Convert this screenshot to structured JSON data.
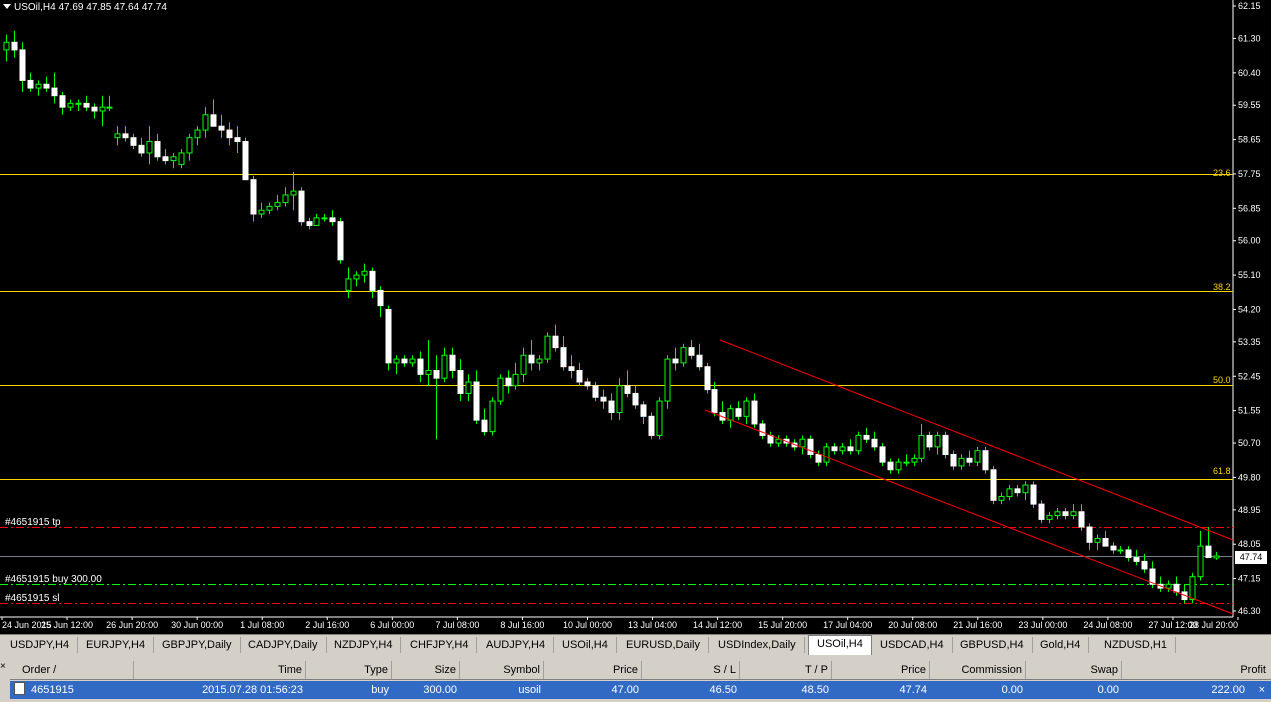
{
  "chart": {
    "title": "USOil,H4  47.69 47.85 47.64 47.74",
    "price_labels": [
      "62.15",
      "61.30",
      "60.40",
      "59.55",
      "58.65",
      "57.75",
      "56.85",
      "56.00",
      "55.10",
      "54.20",
      "53.35",
      "52.45",
      "51.55",
      "50.70",
      "49.80",
      "48.95",
      "48.05",
      "47.15",
      "46.30"
    ],
    "time_labels": [
      "24 Jun 2015",
      "25 Jun 12:00",
      "26 Jun 20:00",
      "30 Jun 00:00",
      "1 Jul 08:00",
      "2 Jul 16:00",
      "6 Jul 00:00",
      "7 Jul 08:00",
      "8 Jul 16:00",
      "10 Jul 00:00",
      "13 Jul 04:00",
      "14 Jul 12:00",
      "15 Jul 20:00",
      "17 Jul 04:00",
      "20 Jul 08:00",
      "21 Jul 16:00",
      "23 Jul 00:00",
      "24 Jul 08:00",
      "27 Jul 12:00",
      "28 Jul 20:00"
    ],
    "fib_levels": [
      "23.6",
      "38.2",
      "50.0",
      "61.8"
    ],
    "fib_level_values": [
      57.75,
      54.69,
      52.22,
      49.75
    ],
    "current_price": "47.74",
    "orders": {
      "tp_label": "#4651915 tp",
      "buy_label": "#4651915 buy 300.00",
      "sl_label": "#4651915 sl",
      "tp": 48.5,
      "buy": 47.0,
      "sl": 46.5
    },
    "colors": {
      "background": "#000000",
      "candle_up": "#ffffff",
      "candle_down": "#00ff00",
      "fib_line": "#ffd700",
      "channel": "#ff0000",
      "tp_sl_line": "#ff0000",
      "buy_line": "#00ff00",
      "current_price_line": "#708090"
    },
    "candles": [
      [
        61.0,
        61.4,
        60.7,
        61.2
      ],
      [
        61.2,
        61.5,
        60.8,
        61.0
      ],
      [
        61.0,
        61.2,
        59.9,
        60.2
      ],
      [
        60.2,
        60.4,
        59.9,
        60.0
      ],
      [
        60.0,
        60.2,
        59.8,
        60.1
      ],
      [
        60.1,
        60.3,
        59.9,
        60.0
      ],
      [
        60.0,
        60.4,
        59.6,
        59.8
      ],
      [
        59.8,
        59.9,
        59.3,
        59.5
      ],
      [
        59.5,
        59.7,
        59.4,
        59.6
      ],
      [
        59.6,
        59.7,
        59.4,
        59.6
      ],
      [
        59.6,
        59.8,
        59.4,
        59.5
      ],
      [
        59.5,
        59.6,
        59.2,
        59.4
      ],
      [
        59.4,
        59.8,
        59.0,
        59.5
      ],
      [
        59.5,
        59.8,
        59.4,
        59.5
      ],
      [
        58.7,
        59.0,
        58.5,
        58.8
      ],
      [
        58.8,
        59.0,
        58.6,
        58.7
      ],
      [
        58.7,
        58.8,
        58.4,
        58.5
      ],
      [
        58.5,
        58.7,
        58.2,
        58.3
      ],
      [
        58.3,
        59.0,
        58.0,
        58.6
      ],
      [
        58.6,
        58.8,
        58.1,
        58.2
      ],
      [
        58.2,
        58.4,
        58.0,
        58.1
      ],
      [
        58.1,
        58.3,
        57.9,
        58.2
      ],
      [
        58.0,
        58.4,
        57.9,
        58.3
      ],
      [
        58.3,
        58.8,
        58.1,
        58.7
      ],
      [
        58.7,
        59.0,
        58.5,
        58.9
      ],
      [
        58.9,
        59.5,
        58.7,
        59.3
      ],
      [
        59.3,
        59.7,
        59.0,
        59.0
      ],
      [
        59.0,
        59.3,
        58.7,
        58.9
      ],
      [
        58.9,
        59.1,
        58.5,
        58.7
      ],
      [
        58.7,
        59.0,
        58.3,
        58.6
      ],
      [
        58.6,
        58.7,
        57.6,
        57.6
      ],
      [
        57.6,
        57.7,
        56.5,
        56.7
      ],
      [
        56.7,
        57.0,
        56.6,
        56.8
      ],
      [
        56.8,
        57.0,
        56.7,
        56.9
      ],
      [
        56.9,
        57.2,
        56.8,
        57.0
      ],
      [
        57.0,
        57.4,
        56.9,
        57.2
      ],
      [
        57.2,
        57.8,
        56.8,
        57.3
      ],
      [
        57.3,
        57.4,
        56.4,
        56.5
      ],
      [
        56.5,
        56.6,
        56.3,
        56.4
      ],
      [
        56.4,
        56.7,
        56.4,
        56.6
      ],
      [
        56.6,
        56.7,
        56.5,
        56.6
      ],
      [
        56.6,
        56.8,
        56.4,
        56.5
      ],
      [
        56.5,
        56.6,
        55.4,
        55.5
      ],
      [
        54.7,
        55.3,
        54.5,
        55.0
      ],
      [
        55.0,
        55.2,
        54.8,
        55.1
      ],
      [
        55.1,
        55.4,
        54.9,
        55.2
      ],
      [
        55.2,
        55.3,
        54.5,
        54.7
      ],
      [
        54.7,
        54.8,
        54.0,
        54.3
      ],
      [
        54.2,
        54.3,
        52.6,
        52.8
      ],
      [
        52.8,
        53.0,
        52.5,
        52.9
      ],
      [
        52.9,
        53.0,
        52.7,
        52.8
      ],
      [
        52.8,
        53.0,
        52.7,
        52.9
      ],
      [
        52.9,
        53.1,
        52.3,
        52.5
      ],
      [
        52.5,
        53.4,
        52.2,
        52.6
      ],
      [
        52.6,
        53.0,
        50.8,
        52.4
      ],
      [
        52.4,
        53.2,
        52.3,
        53.0
      ],
      [
        53.0,
        53.2,
        52.4,
        52.6
      ],
      [
        52.6,
        52.9,
        51.8,
        52.0
      ],
      [
        52.0,
        52.5,
        51.8,
        52.3
      ],
      [
        52.3,
        52.6,
        51.2,
        51.3
      ],
      [
        51.3,
        51.6,
        50.9,
        51.0
      ],
      [
        51.0,
        51.9,
        50.9,
        51.8
      ],
      [
        51.8,
        52.5,
        51.7,
        52.4
      ],
      [
        52.4,
        52.6,
        52.0,
        52.2
      ],
      [
        52.2,
        52.8,
        52.1,
        52.5
      ],
      [
        52.5,
        53.2,
        52.3,
        53.0
      ],
      [
        53.0,
        53.4,
        52.6,
        52.8
      ],
      [
        52.8,
        53.0,
        52.6,
        52.9
      ],
      [
        52.9,
        53.6,
        52.8,
        53.5
      ],
      [
        53.5,
        53.8,
        53.1,
        53.2
      ],
      [
        53.2,
        53.5,
        52.6,
        52.7
      ],
      [
        52.7,
        53.0,
        52.4,
        52.6
      ],
      [
        52.6,
        52.8,
        52.2,
        52.3
      ],
      [
        52.3,
        52.4,
        52.1,
        52.2
      ],
      [
        52.2,
        52.3,
        51.8,
        51.9
      ],
      [
        51.9,
        52.1,
        51.6,
        51.8
      ],
      [
        51.8,
        52.0,
        51.3,
        51.5
      ],
      [
        51.5,
        52.4,
        51.3,
        52.2
      ],
      [
        52.2,
        52.6,
        51.9,
        52.0
      ],
      [
        52.0,
        52.2,
        51.6,
        51.7
      ],
      [
        51.7,
        51.8,
        51.2,
        51.4
      ],
      [
        51.4,
        51.5,
        50.8,
        50.9
      ],
      [
        50.9,
        51.9,
        50.8,
        51.8
      ],
      [
        51.8,
        53.0,
        51.6,
        52.9
      ],
      [
        52.9,
        53.2,
        52.6,
        52.8
      ],
      [
        52.8,
        53.3,
        52.7,
        53.2
      ],
      [
        53.2,
        53.4,
        52.9,
        53.0
      ],
      [
        53.0,
        53.3,
        52.6,
        52.7
      ],
      [
        52.7,
        52.8,
        52.0,
        52.1
      ],
      [
        52.1,
        52.3,
        51.4,
        51.5
      ],
      [
        51.5,
        51.8,
        51.2,
        51.3
      ],
      [
        51.3,
        51.7,
        51.1,
        51.6
      ],
      [
        51.6,
        51.8,
        51.3,
        51.4
      ],
      [
        51.4,
        51.9,
        51.2,
        51.8
      ],
      [
        51.8,
        52.0,
        51.1,
        51.2
      ],
      [
        51.2,
        51.3,
        50.8,
        50.9
      ],
      [
        50.9,
        51.0,
        50.6,
        50.7
      ],
      [
        50.7,
        50.9,
        50.6,
        50.8
      ],
      [
        50.8,
        50.9,
        50.6,
        50.7
      ],
      [
        50.7,
        50.8,
        50.5,
        50.6
      ],
      [
        50.6,
        50.9,
        50.4,
        50.8
      ],
      [
        50.8,
        50.9,
        50.3,
        50.4
      ],
      [
        50.4,
        50.5,
        50.1,
        50.2
      ],
      [
        50.2,
        50.7,
        50.1,
        50.6
      ],
      [
        50.6,
        50.7,
        50.4,
        50.5
      ],
      [
        50.5,
        50.7,
        50.4,
        50.6
      ],
      [
        50.6,
        50.8,
        50.4,
        50.5
      ],
      [
        50.5,
        51.0,
        50.4,
        50.9
      ],
      [
        50.9,
        51.1,
        50.7,
        50.8
      ],
      [
        50.8,
        51.0,
        50.5,
        50.6
      ],
      [
        50.6,
        50.7,
        50.1,
        50.2
      ],
      [
        50.2,
        50.3,
        49.9,
        50.0
      ],
      [
        50.0,
        50.3,
        49.9,
        50.2
      ],
      [
        50.2,
        50.4,
        50.1,
        50.2
      ],
      [
        50.2,
        50.4,
        50.1,
        50.3
      ],
      [
        50.3,
        51.2,
        50.2,
        50.9
      ],
      [
        50.9,
        51.0,
        50.5,
        50.6
      ],
      [
        50.6,
        51.0,
        50.4,
        50.9
      ],
      [
        50.9,
        51.0,
        50.3,
        50.4
      ],
      [
        50.4,
        50.5,
        50.0,
        50.1
      ],
      [
        50.1,
        50.4,
        50.0,
        50.3
      ],
      [
        50.3,
        50.5,
        50.1,
        50.2
      ],
      [
        50.2,
        50.6,
        50.1,
        50.5
      ],
      [
        50.5,
        50.6,
        49.9,
        50.0
      ],
      [
        50.0,
        50.1,
        49.1,
        49.2
      ],
      [
        49.2,
        49.4,
        49.1,
        49.3
      ],
      [
        49.3,
        49.6,
        49.2,
        49.5
      ],
      [
        49.5,
        49.6,
        49.3,
        49.4
      ],
      [
        49.4,
        49.7,
        49.2,
        49.6
      ],
      [
        49.6,
        49.7,
        49.0,
        49.1
      ],
      [
        49.1,
        49.2,
        48.6,
        48.7
      ],
      [
        48.7,
        48.9,
        48.6,
        48.8
      ],
      [
        48.8,
        49.0,
        48.7,
        48.9
      ],
      [
        48.9,
        49.0,
        48.7,
        48.8
      ],
      [
        48.8,
        49.1,
        48.7,
        48.9
      ],
      [
        48.9,
        49.1,
        48.4,
        48.5
      ],
      [
        48.5,
        48.6,
        47.9,
        48.1
      ],
      [
        48.1,
        48.3,
        47.9,
        48.2
      ],
      [
        48.2,
        48.4,
        48.0,
        48.0
      ],
      [
        48.0,
        48.1,
        47.8,
        47.9
      ],
      [
        47.9,
        48.0,
        47.8,
        47.9
      ],
      [
        47.9,
        48.0,
        47.6,
        47.7
      ],
      [
        47.7,
        47.9,
        47.5,
        47.6
      ],
      [
        47.6,
        47.8,
        47.3,
        47.4
      ],
      [
        47.4,
        47.6,
        46.9,
        47.0
      ],
      [
        47.0,
        47.2,
        46.8,
        46.9
      ],
      [
        46.9,
        47.1,
        46.8,
        47.0
      ],
      [
        47.0,
        47.2,
        46.7,
        46.8
      ],
      [
        46.8,
        47.0,
        46.5,
        46.6
      ],
      [
        46.6,
        47.3,
        46.5,
        47.2
      ],
      [
        47.2,
        48.4,
        47.1,
        48.0
      ],
      [
        48.0,
        48.5,
        47.7,
        47.7
      ],
      [
        47.69,
        47.85,
        47.64,
        47.74
      ]
    ]
  },
  "tabs": [
    "USDJPY,H4",
    "EURJPY,H4",
    "GBPJPY,Daily",
    "CADJPY,Daily",
    "NZDJPY,H4",
    "CHFJPY,H4",
    "AUDJPY,H4",
    "USOil,H4",
    "EURUSD,Daily",
    "USDIndex,Daily",
    "USOil,H4",
    "USDCAD,H4",
    "GBPUSD,H4",
    "Gold,H4",
    "NZDUSD,H1"
  ],
  "active_tab_index": 10,
  "terminal": {
    "close_glyph": "×",
    "headers": {
      "order": "Order   /",
      "time": "Time",
      "type": "Type",
      "size": "Size",
      "symbol": "Symbol",
      "price": "Price",
      "sl": "S / L",
      "tp": "T / P",
      "price2": "Price",
      "commission": "Commission",
      "swap": "Swap",
      "profit": "Profit"
    },
    "row": {
      "order": "4651915",
      "time": "2015.07.28 01:56:23",
      "type": "buy",
      "size": "300.00",
      "symbol": "usoil",
      "price": "47.00",
      "sl": "46.50",
      "tp": "48.50",
      "price2": "47.74",
      "commission": "0.00",
      "swap": "0.00",
      "profit": "222.00",
      "close_glyph": "×"
    }
  }
}
